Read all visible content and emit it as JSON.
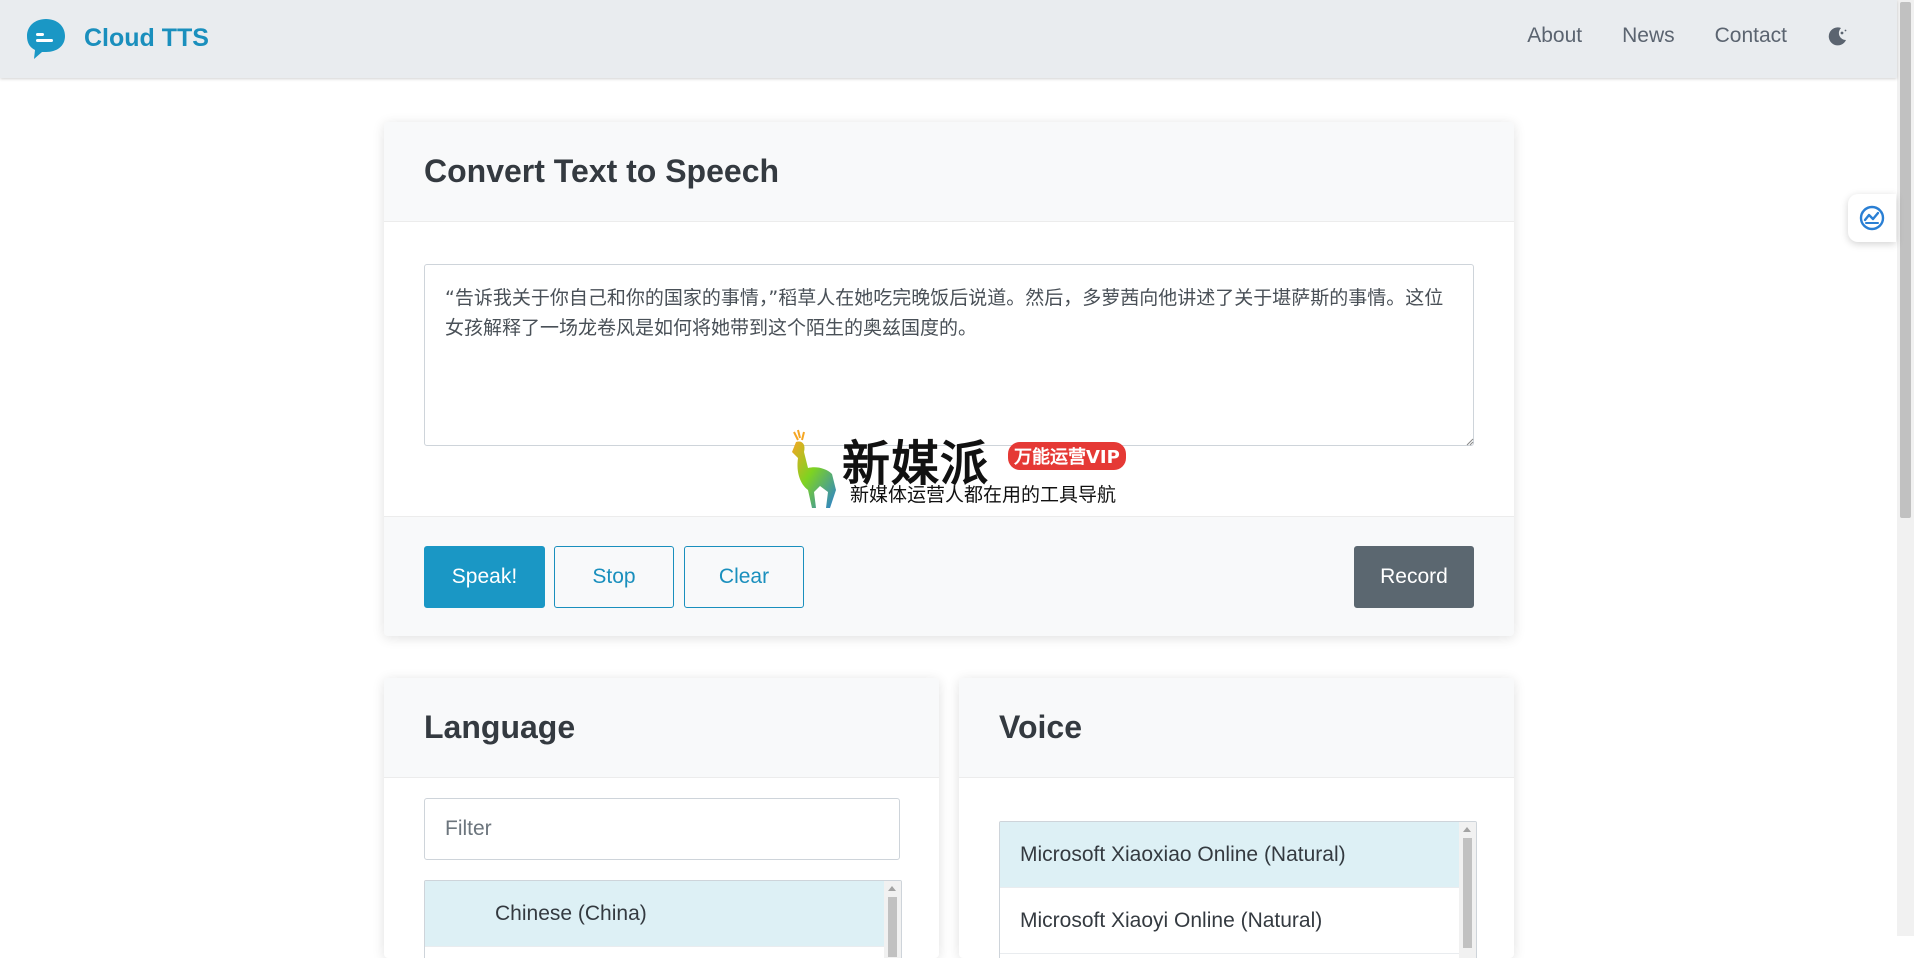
{
  "navbar": {
    "brand": "Cloud TTS",
    "links": [
      "About",
      "News",
      "Contact"
    ],
    "theme_icon": "moon-icon",
    "brand_color": "#1a8fbd"
  },
  "tts": {
    "title": "Convert Text to Speech",
    "text": "“告诉我关于你自己和你的国家的事情，”稻草人在她吃完晚饭后说道。然后，多萝茜向他讲述了关于堪萨斯的事情。这位女孩解释了一场龙卷风是如何将她带到这个陌生的奥兹国度的。",
    "speak_label": "Speak!",
    "stop_label": "Stop",
    "clear_label": "Clear",
    "record_label": "Record"
  },
  "watermark": {
    "title": "新媒派",
    "badge": "万能运营VIP",
    "subtitle": "新媒体运营人都在用的工具导航"
  },
  "language": {
    "title": "Language",
    "filter_placeholder": "Filter",
    "options": [
      "Chinese (China)"
    ]
  },
  "voice": {
    "title": "Voice",
    "options": [
      "Microsoft Xiaoxiao Online (Natural)",
      "Microsoft Xiaoyi Online (Natural)"
    ]
  }
}
